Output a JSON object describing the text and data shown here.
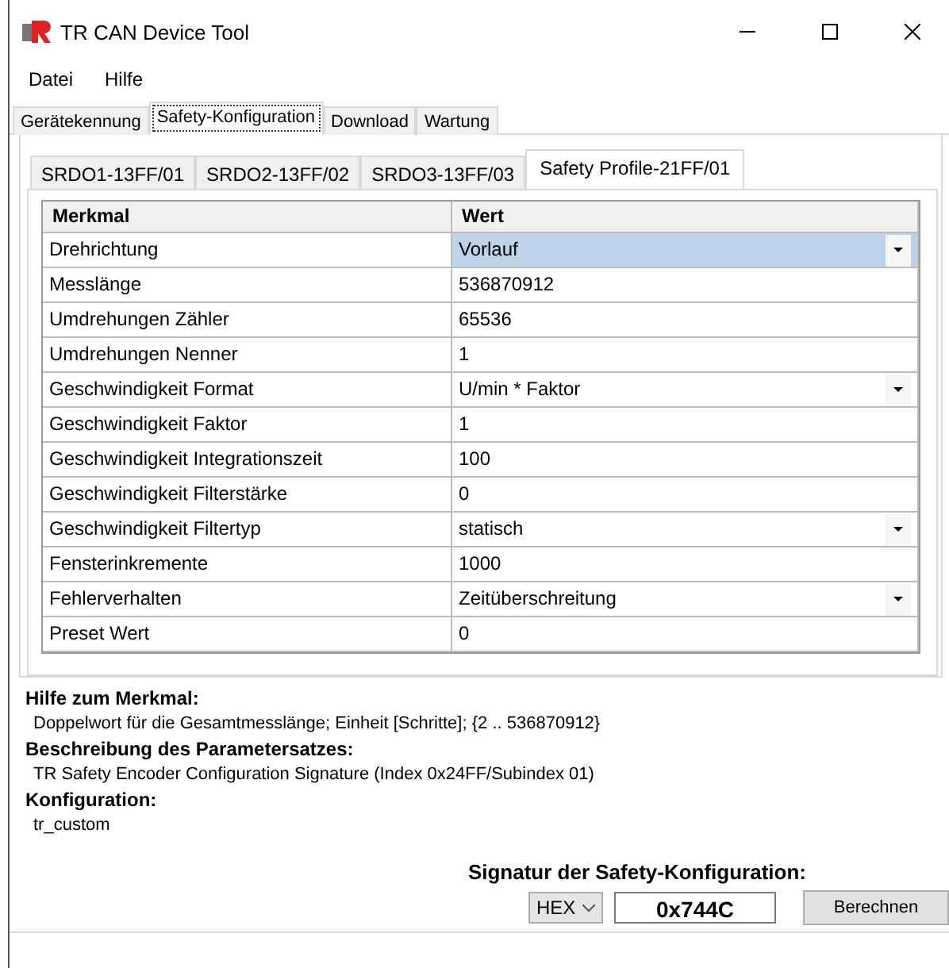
{
  "window": {
    "title": "TR CAN Device Tool"
  },
  "menu": [
    "Datei",
    "Hilfe"
  ],
  "tabs": [
    {
      "label": "Gerätekennung",
      "selected": false
    },
    {
      "label": "Safety-Konfiguration",
      "selected": true
    },
    {
      "label": "Download",
      "selected": false
    },
    {
      "label": "Wartung",
      "selected": false
    }
  ],
  "subtabs": [
    {
      "label": "SRDO1-13FF/01",
      "selected": false
    },
    {
      "label": "SRDO2-13FF/02",
      "selected": false
    },
    {
      "label": "SRDO3-13FF/03",
      "selected": false
    },
    {
      "label": "Safety Profile-21FF/01",
      "selected": true
    }
  ],
  "table": {
    "columns": [
      "Merkmal",
      "Wert"
    ],
    "rows": [
      {
        "name": "Drehrichtung",
        "value": "Vorlauf",
        "kind": "dropdown",
        "selected": true
      },
      {
        "name": "Messlänge",
        "value": "536870912",
        "kind": "text",
        "selected": false
      },
      {
        "name": "Umdrehungen Zähler",
        "value": "65536",
        "kind": "text",
        "selected": false
      },
      {
        "name": "Umdrehungen Nenner",
        "value": "1",
        "kind": "text",
        "selected": false
      },
      {
        "name": "Geschwindigkeit Format",
        "value": "U/min * Faktor",
        "kind": "dropdown",
        "selected": false
      },
      {
        "name": "Geschwindigkeit Faktor",
        "value": "1",
        "kind": "text",
        "selected": false
      },
      {
        "name": "Geschwindigkeit Integrationszeit",
        "value": "100",
        "kind": "text",
        "selected": false
      },
      {
        "name": "Geschwindigkeit Filterstärke",
        "value": "0",
        "kind": "text",
        "selected": false
      },
      {
        "name": "Geschwindigkeit Filtertyp",
        "value": "statisch",
        "kind": "dropdown",
        "selected": false
      },
      {
        "name": "Fensterinkremente",
        "value": "1000",
        "kind": "text",
        "selected": false
      },
      {
        "name": "Fehlerverhalten",
        "value": "Zeitüberschreitung",
        "kind": "dropdown",
        "selected": false
      },
      {
        "name": "Preset Wert",
        "value": "0",
        "kind": "text",
        "selected": false
      }
    ]
  },
  "info": [
    {
      "heading": "Hilfe zum Merkmal:",
      "text": "Doppelwort für die Gesamtmesslänge; Einheit [Schritte]; {2 .. 536870912}"
    },
    {
      "heading": "Beschreibung des Parametersatzes:",
      "text": "TR Safety Encoder Configuration Signature (Index 0x24FF/Subindex 01)"
    },
    {
      "heading": "Konfiguration:",
      "text": "tr_custom"
    }
  ],
  "signature": {
    "label": "Signatur der Safety-Konfiguration:",
    "format": "HEX",
    "value": "0x744C",
    "button": "Berechnen"
  }
}
